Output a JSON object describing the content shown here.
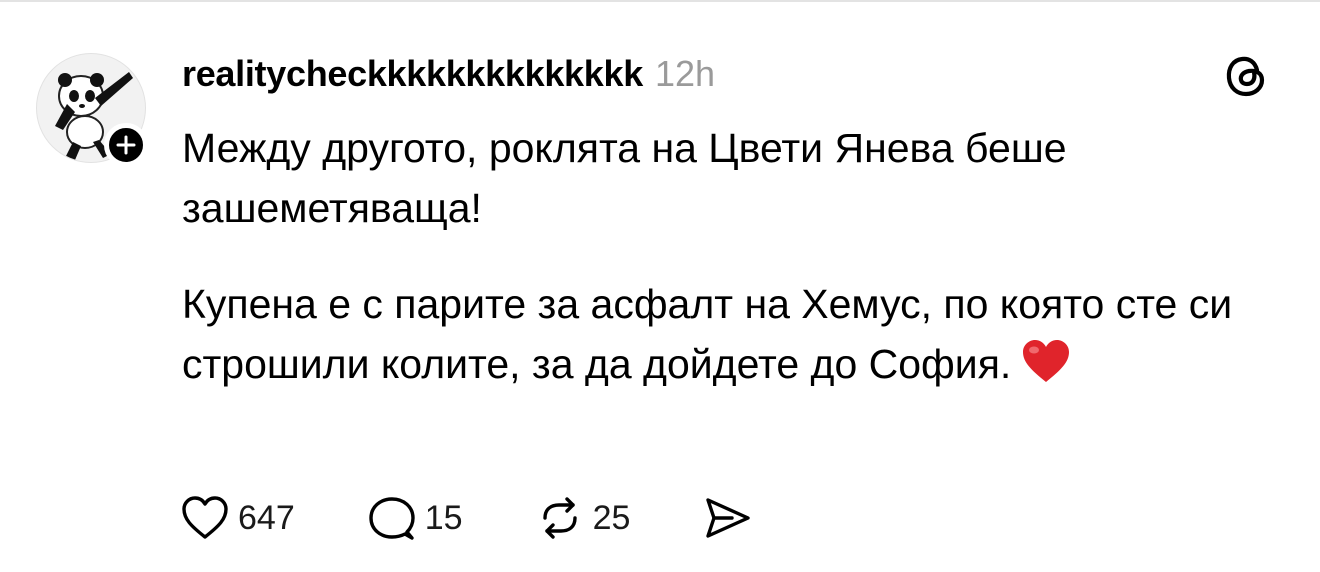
{
  "post": {
    "username": "realitycheckkkkkkkkkkkkkk",
    "time": "12h",
    "paragraph1": "Между другото, роклята на Цвети Янева беше зашеметяваща!",
    "paragraph2": "Купена е с парите за асфалт на Хемус, по която сте си строшили колите, за да дойдете до София.",
    "emoji": "heart-emoji"
  },
  "actions": {
    "likes": "647",
    "replies": "15",
    "reposts": "25"
  },
  "icons": {
    "app": "threads-logo-icon",
    "like": "heart-icon",
    "reply": "speech-bubble-icon",
    "repost": "repost-icon",
    "share": "send-icon",
    "follow": "plus-icon"
  },
  "colors": {
    "text": "#000000",
    "muted": "#9a9a9a",
    "heart": "#e0242b"
  }
}
